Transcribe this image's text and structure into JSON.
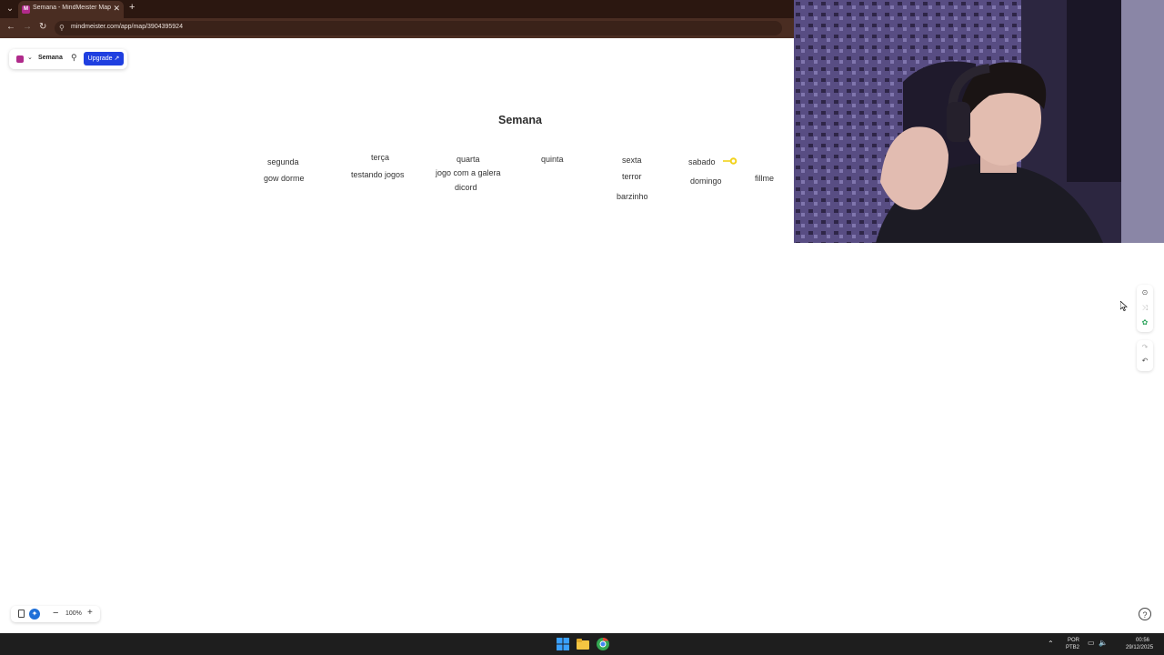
{
  "browser": {
    "tab_title": "Semana - MindMeister Mapa m",
    "new_tab": "+",
    "close": "✕",
    "url": "mindmeister.com/app/map/3904395924"
  },
  "toolbar": {
    "map_title": "Semana",
    "upgrade_label": "Upgrade ↗",
    "logo_letter": "M"
  },
  "mindmap": {
    "root": "Semana",
    "nodes": {
      "segunda": "segunda",
      "gow_dorme": "gow dorme",
      "terca": "terça",
      "testando_jogos": "testando jogos",
      "quarta": "quarta",
      "jogo_com_a_galera": "jogo com a galera",
      "dicord": "dicord",
      "quinta": "quinta",
      "sexta": "sexta",
      "terror": "terror",
      "barzinho": "barzinho",
      "sabado": "sabado",
      "domingo": "domingo",
      "fillme": "fillme"
    },
    "marker_color": "#f2d21b"
  },
  "zoom": {
    "level": "100%",
    "minus": "−",
    "plus": "+"
  },
  "taskbar": {
    "lang_top": "POR",
    "lang_bottom": "PTB2",
    "time": "00:56",
    "date": "29/12/2025"
  },
  "colors": {
    "accent": "#1f3fe0",
    "brand": "#b02a8b",
    "browser_dark": "#2b1710"
  }
}
